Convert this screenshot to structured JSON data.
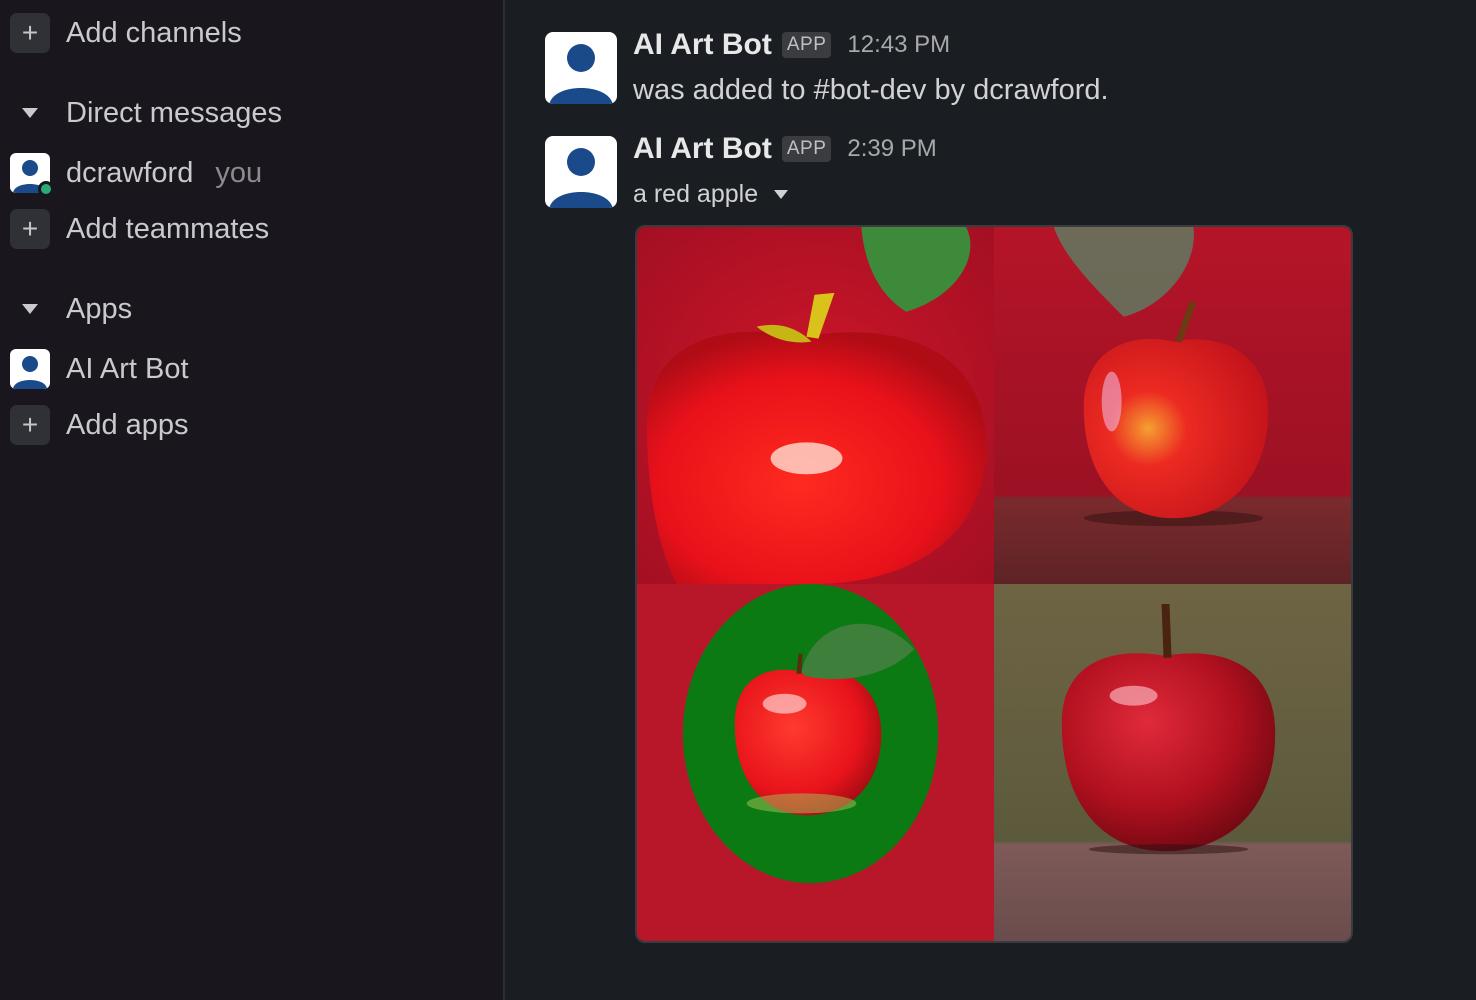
{
  "sidebar": {
    "add_channels": "Add channels",
    "direct_messages_header": "Direct messages",
    "dm_user": {
      "name": "dcrawford",
      "suffix": "you"
    },
    "add_teammates": "Add teammates",
    "apps_header": "Apps",
    "app_item": "AI Art Bot",
    "add_apps": "Add apps"
  },
  "messages": [
    {
      "author": "AI Art Bot",
      "badge": "APP",
      "time": "12:43 PM",
      "text": "was added to #bot-dev by dcrawford."
    },
    {
      "author": "AI Art Bot",
      "badge": "APP",
      "time": "2:39 PM",
      "caption": "a red apple"
    }
  ],
  "colors": {
    "background": "#1a1d21",
    "sidebar": "#19171d",
    "presence": "#2bac76",
    "avatar_blue": "#1a4a8a"
  }
}
